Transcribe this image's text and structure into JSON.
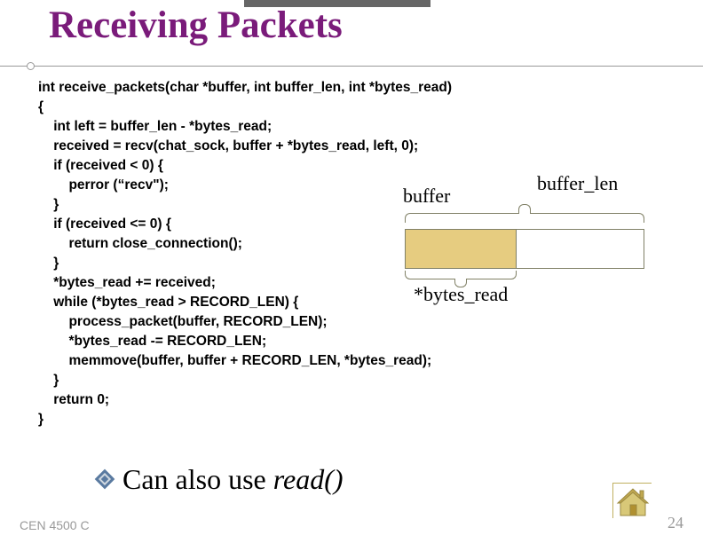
{
  "title": "Receiving Packets",
  "code": {
    "l01": "int receive_packets(char *buffer, int buffer_len, int *bytes_read)",
    "l02": "{",
    "l03": "    int left = buffer_len - *bytes_read;",
    "l04": "    received = recv(chat_sock, buffer + *bytes_read, left, 0);",
    "l05": "    if (received < 0) {",
    "l06": "        perror (“recv\");",
    "l07": "    }",
    "l08": "    if (received <= 0) {",
    "l09": "        return close_connection();",
    "l10": "    }",
    "l11": "    *bytes_read += received;",
    "l12": "    while (*bytes_read > RECORD_LEN) {",
    "l13": "        process_packet(buffer, RECORD_LEN);",
    "l14": "        *bytes_read -= RECORD_LEN;",
    "l15": "        memmove(buffer, buffer + RECORD_LEN, *bytes_read);",
    "l16": "    }",
    "l17": "    return 0;",
    "l18": "}"
  },
  "diagram": {
    "buffer": "buffer",
    "buffer_len": "buffer_len",
    "bytes_read": "*bytes_read"
  },
  "bullet": {
    "prefix": "Can also use ",
    "func": "read()"
  },
  "footer": {
    "left": "CEN 4500 C",
    "right": "24"
  }
}
